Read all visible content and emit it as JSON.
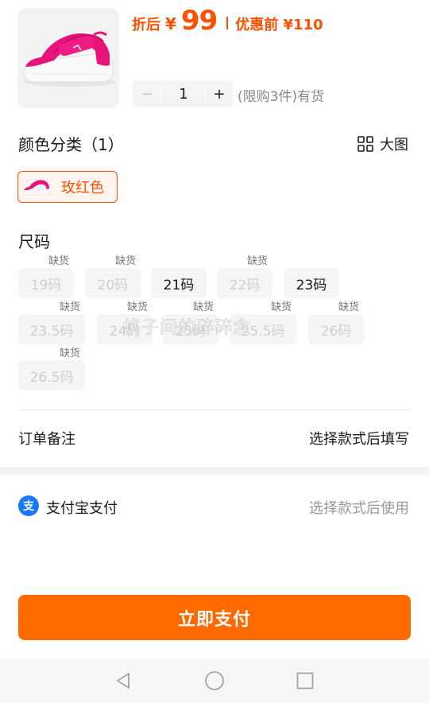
{
  "product": {
    "price_prefix": "折后",
    "currency": "¥",
    "price_value": "99",
    "price_before": "优惠前 ¥110"
  },
  "quantity": {
    "minus": "−",
    "value": "1",
    "plus": "+",
    "stock_text": "(限购3件)有货"
  },
  "color_section": {
    "title": "颜色分类（1）",
    "big_image_label": "大图",
    "options": [
      {
        "label": "玫红色",
        "selected": true
      }
    ]
  },
  "size_section": {
    "title": "尺码",
    "out_of_stock_badge": "缺货",
    "sizes": [
      {
        "label": "19码",
        "available": false
      },
      {
        "label": "20码",
        "available": false
      },
      {
        "label": "21码",
        "available": true
      },
      {
        "label": "22码",
        "available": false
      },
      {
        "label": "23码",
        "available": true
      },
      {
        "label": "23.5码",
        "available": false
      },
      {
        "label": "24码",
        "available": false
      },
      {
        "label": "25码",
        "available": false
      },
      {
        "label": "25.5码",
        "available": false
      },
      {
        "label": "26码",
        "available": false
      },
      {
        "label": "26.5码",
        "available": false
      }
    ]
  },
  "watermark": "格子间的碎碎念",
  "order_note": {
    "label": "订单备注",
    "value": "选择款式后填写"
  },
  "payment": {
    "method": "支付宝支付",
    "hint": "选择款式后使用"
  },
  "pay_button": "立即支付",
  "colors": {
    "accent": "#ff5000",
    "pay_button": "#ff6a00",
    "alipay_blue": "#1677ff"
  },
  "icons": [
    "grid-icon",
    "alipay-icon",
    "nav-back-icon",
    "nav-home-icon",
    "nav-recents-icon"
  ]
}
